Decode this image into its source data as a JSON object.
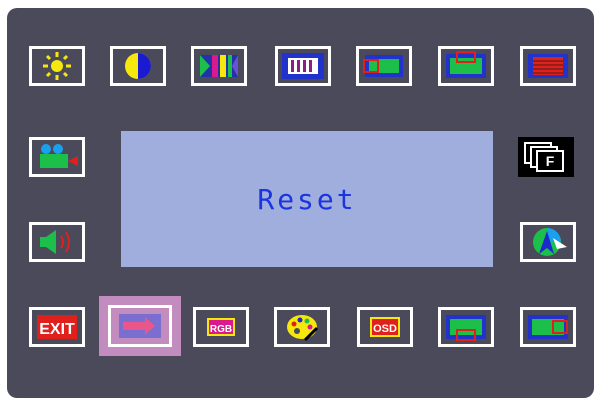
{
  "menu": {
    "selected_index": 13,
    "status_text": "Reset",
    "tiles": [
      {
        "icon": "brightness-icon"
      },
      {
        "icon": "contrast-icon"
      },
      {
        "icon": "color-bars-icon"
      },
      {
        "icon": "clock-phase-icon"
      },
      {
        "icon": "h-position-icon"
      },
      {
        "icon": "v-position-icon"
      },
      {
        "icon": "sharpness-icon"
      },
      {
        "icon": "camera-source-icon"
      },
      {
        "icon": "format-icon"
      },
      {
        "icon": "volume-icon"
      },
      {
        "icon": "auto-adjust-icon"
      },
      {
        "icon": "exit-icon",
        "label": "EXIT"
      },
      {
        "icon": "reset-arrow-icon"
      },
      {
        "icon": "rgb-icon",
        "label": "RGB"
      },
      {
        "icon": "palette-icon"
      },
      {
        "icon": "osd-icon",
        "label": "OSD"
      },
      {
        "icon": "osd-v-position-icon"
      },
      {
        "icon": "osd-h-position-icon"
      }
    ],
    "labels": {
      "exit": "EXIT",
      "rgb": "RGB",
      "osd": "OSD",
      "format": "F"
    }
  },
  "colors": {
    "background": "#4a4a5a",
    "display_bg": "#a0aede",
    "display_text": "#1c34e0",
    "selection": "#c28dbe"
  }
}
